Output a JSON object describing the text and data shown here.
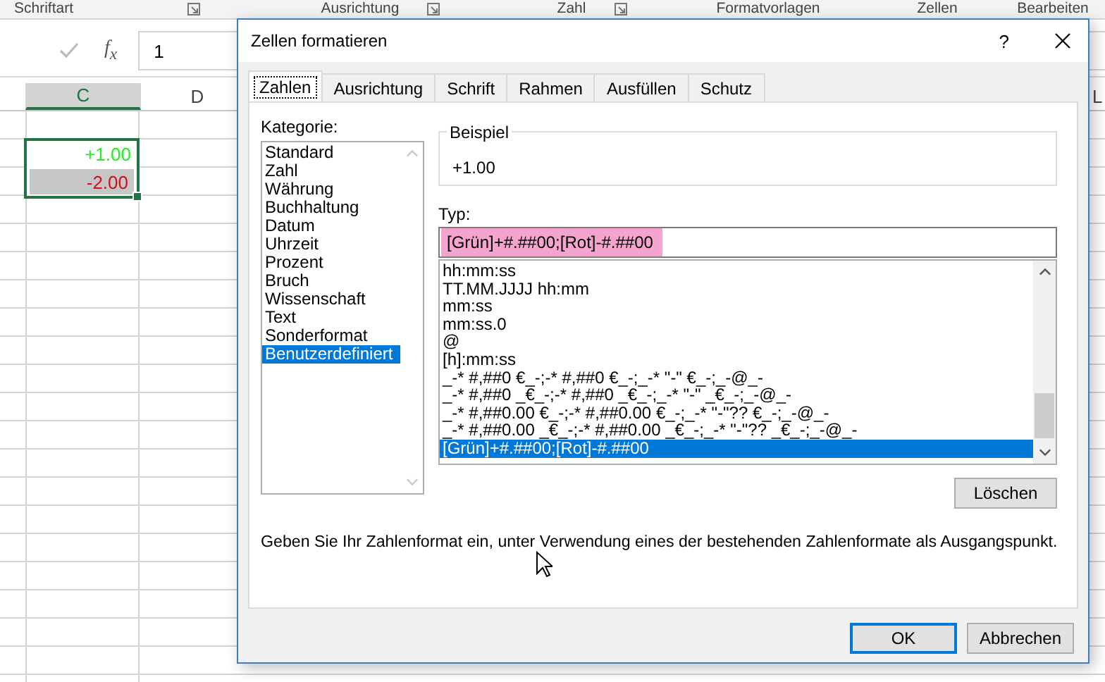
{
  "ribbon_groups": [
    {
      "label": "Schriftart",
      "launcher": true
    },
    {
      "label": "Ausrichtung",
      "launcher": true
    },
    {
      "label": "Zahl",
      "launcher": true
    },
    {
      "label": "Formatvorlagen",
      "launcher": false
    },
    {
      "label": "Zellen",
      "launcher": false
    },
    {
      "label": "Bearbeiten",
      "launcher": false
    }
  ],
  "formula_bar": {
    "function_label": "f$_{x}$",
    "value": "1"
  },
  "columns": [
    {
      "label": "C",
      "selected": true
    },
    {
      "label": "D",
      "selected": false
    },
    {
      "label": "L",
      "selected": false
    }
  ],
  "cells": [
    {
      "text": "+1.00",
      "color": "#22ee22",
      "active": true
    },
    {
      "text": "-2.00",
      "color": "#d0101a",
      "active": false
    }
  ],
  "dialog": {
    "title": "Zellen formatieren",
    "help": "?",
    "tabs": [
      {
        "label": "Zahlen",
        "selected": true
      },
      {
        "label": "Ausrichtung",
        "selected": false
      },
      {
        "label": "Schrift",
        "selected": false
      },
      {
        "label": "Rahmen",
        "selected": false
      },
      {
        "label": "Ausfüllen",
        "selected": false
      },
      {
        "label": "Schutz",
        "selected": false
      }
    ],
    "category_label": "Kategorie:",
    "categories": [
      {
        "label": "Standard",
        "selected": false
      },
      {
        "label": "Zahl",
        "selected": false
      },
      {
        "label": "Währung",
        "selected": false
      },
      {
        "label": "Buchhaltung",
        "selected": false
      },
      {
        "label": "Datum",
        "selected": false
      },
      {
        "label": "Uhrzeit",
        "selected": false
      },
      {
        "label": "Prozent",
        "selected": false
      },
      {
        "label": "Bruch",
        "selected": false
      },
      {
        "label": "Wissenschaft",
        "selected": false
      },
      {
        "label": "Text",
        "selected": false
      },
      {
        "label": "Sonderformat",
        "selected": false
      },
      {
        "label": "Benutzerdefiniert",
        "selected": true
      }
    ],
    "sample_label": "Beispiel",
    "sample_value": "+1.00",
    "type_label": "Typ:",
    "type_value": "[Grün]+#.##00;[Rot]-#.##00",
    "type_highlighted": true,
    "formats": [
      {
        "text": "hh:mm:ss",
        "selected": false
      },
      {
        "text": "TT.MM.JJJJ hh:mm",
        "selected": false
      },
      {
        "text": "mm:ss",
        "selected": false
      },
      {
        "text": "mm:ss.0",
        "selected": false
      },
      {
        "text": "@",
        "selected": false
      },
      {
        "text": "[h]:mm:ss",
        "selected": false
      },
      {
        "text": "_-* #,##0 €_-;-* #,##0 €_-;_-* \"-\" €_-;_-@_-",
        "selected": false
      },
      {
        "text": "_-* #,##0 _€_-;-* #,##0 _€_-;_-* \"-\" _€_-;_-@_-",
        "selected": false
      },
      {
        "text": "_-* #,##0.00 €_-;-* #,##0.00 €_-;_-* \"-\"?? €_-;_-@_-",
        "selected": false
      },
      {
        "text": "_-* #,##0.00 _€_-;-* #,##0.00 _€_-;_-* \"-\"?? _€_-;_-@_-",
        "selected": false
      },
      {
        "text": "[Grün]+#.##00;[Rot]-#.##00",
        "selected": true
      }
    ],
    "delete_button": "Löschen",
    "hint": "Geben Sie Ihr Zahlenformat ein, unter Verwendung eines der bestehenden Zahlenformate als Ausgangspunkt.",
    "buttons": [
      {
        "label": "OK",
        "default": true
      },
      {
        "label": "Abbrechen",
        "default": false
      }
    ]
  }
}
